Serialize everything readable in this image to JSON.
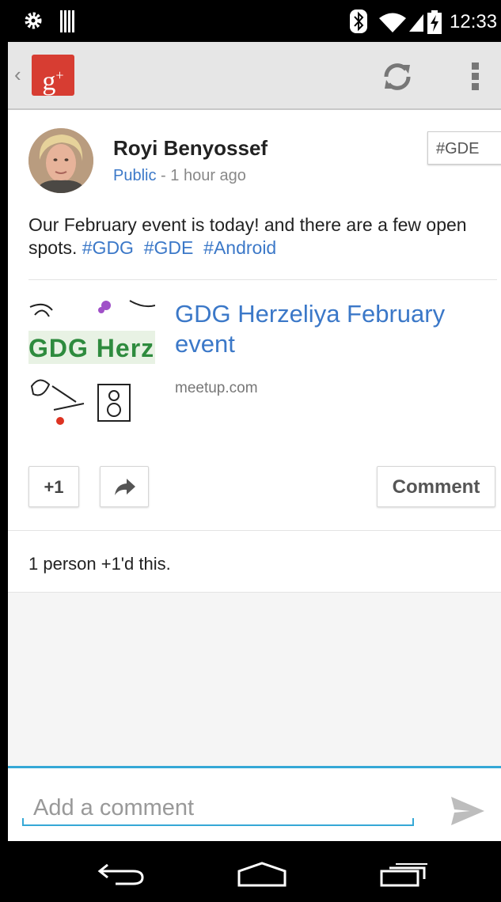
{
  "status_bar": {
    "time": "12:33",
    "icons": [
      "settings-icon",
      "barcode-icon",
      "bluetooth-icon",
      "wifi-icon",
      "signal-icon",
      "battery-charging-icon"
    ]
  },
  "action_bar": {
    "app_logo": "g+",
    "icons": [
      "back-caret-icon",
      "refresh-icon",
      "overflow-menu-icon"
    ]
  },
  "post": {
    "author": "Royi Benyossef",
    "visibility": "Public",
    "separator": " - ",
    "time_ago": "1 hour ago",
    "tag_chip": "#GDE",
    "text": "Our February event is today! and there are a few open spots.",
    "hashtags": [
      "#GDG",
      "#GDE",
      "#Android"
    ],
    "link": {
      "title": "GDG Herzeliya February event",
      "domain": "meetup.com",
      "thumbnail_text": "GDG Herz"
    },
    "buttons": {
      "plus_one": "+1",
      "share_icon": "share-arrow-icon",
      "comment": "Comment"
    },
    "plus_ones_text": "1 person +1'd this."
  },
  "comment_bar": {
    "placeholder": "Add a comment",
    "send_icon": "send-icon"
  },
  "nav_bar": {
    "icons": [
      "nav-back-icon",
      "nav-home-icon",
      "nav-recents-icon"
    ]
  },
  "colors": {
    "link_blue": "#3b78c8",
    "gplus_red": "#d73d32",
    "accent_cyan": "#35a8d6"
  }
}
